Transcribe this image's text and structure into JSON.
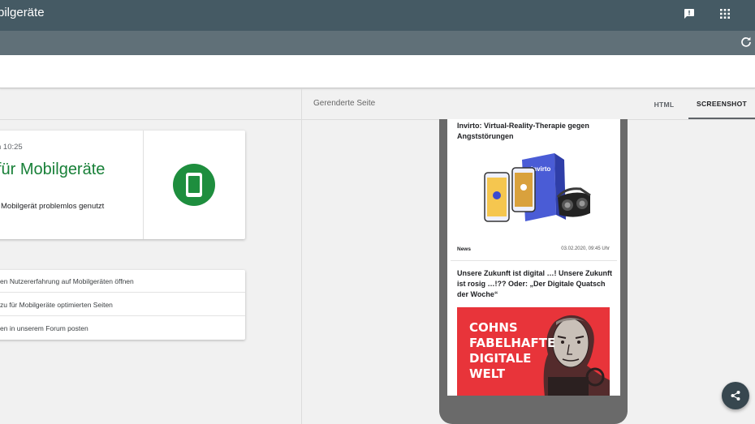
{
  "app": {
    "title": "Test auf Optimierung für Mobilgeräte"
  },
  "header": {
    "title_visible": "bilgeräte",
    "feedback_icon": "feedback-icon",
    "apps_icon": "apps-grid-icon",
    "refresh_icon": "refresh-icon"
  },
  "result": {
    "date": "n 10:25",
    "verdict": "für Mobilgeräte",
    "description": "Mobilgerät problemlos genutzt",
    "icon": "smartphone-icon",
    "accent_color": "#1e8e3e"
  },
  "links": [
    {
      "label": "en Nutzererfahrung auf Mobilgeräten öffnen"
    },
    {
      "label": "zu für Mobilgeräte optimierten Seiten"
    },
    {
      "label": "en in unserem Forum posten"
    }
  ],
  "rendered": {
    "label": "Gerenderte Seite",
    "tabs": [
      {
        "label": "HTML"
      },
      {
        "label": "SCREENSHOT"
      }
    ],
    "active_tab": "SCREENSHOT"
  },
  "articles": [
    {
      "title": "Invirto: Virtual-Reality-Therapie gegen Angststörungen",
      "category": "News",
      "date": "03.02.2020, 09:45 Uhr",
      "image_brand": "invirto"
    },
    {
      "title": "Unsere Zukunft ist digital …! Unsere Zukunft ist rosig …!?? Oder: „Der Digitale Quatsch der Woche“",
      "image_text": [
        "COHNS",
        "FABELHAFTE",
        "DIGITALE",
        "WELT"
      ]
    }
  ],
  "share_icon": "share-icon"
}
